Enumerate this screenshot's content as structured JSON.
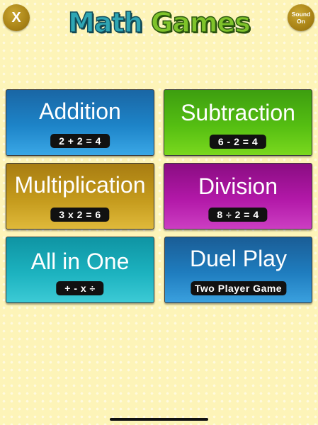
{
  "header": {
    "close_label": "X",
    "title_word1": "Math",
    "title_word2": "Games",
    "sound_line1": "Sound",
    "sound_line2": "On"
  },
  "cards": {
    "addition": {
      "name": "Addition",
      "example": "2 + 2 = 4"
    },
    "subtraction": {
      "name": "Subtraction",
      "example": "6 - 2 = 4"
    },
    "multiplication": {
      "name": "Multiplication",
      "example": "3 x 2 = 6"
    },
    "division": {
      "name": "Division",
      "example": "8 ÷ 2 = 4"
    },
    "all_in_one": {
      "name": "All in One",
      "example": "+ - x ÷"
    },
    "duel_play": {
      "name": "Duel Play",
      "example": "Two Player Game"
    }
  },
  "colors": {
    "background": "#fdf4b8",
    "addition": "#1d84c8",
    "subtraction": "#55be12",
    "multiplication": "#c49a1c",
    "division": "#b218a8",
    "all_in_one": "#1cb2bf",
    "duel_play": "#1f7dbf",
    "button_gold": "#a98316"
  }
}
